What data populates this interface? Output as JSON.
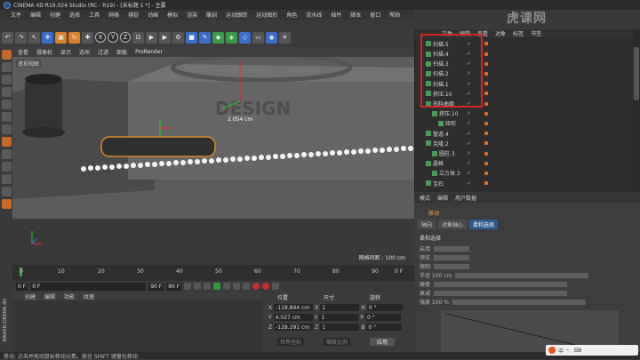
{
  "window": {
    "title": "CINEMA 4D R19.024 Studio (RC - R19) - [未标题 1 *] - 主要"
  },
  "watermark": "虎课网",
  "menu": [
    "文件",
    "编辑",
    "创建",
    "选择",
    "工具",
    "网格",
    "捕捉",
    "动画",
    "模拟",
    "渲染",
    "雕刻",
    "运动跟踪",
    "运动图形",
    "角色",
    "流水线",
    "插件",
    "脚本",
    "窗口",
    "帮助"
  ],
  "viewport": {
    "menu": [
      "查看",
      "摄像机",
      "显示",
      "选项",
      "过滤",
      "面板",
      "ProRender"
    ],
    "label": "透视视图",
    "dimension": "2.054 cm",
    "grid_distance": "网格间距 : 100 cm"
  },
  "timeline": {
    "ticks": [
      "0",
      "10",
      "20",
      "30",
      "40",
      "50",
      "60",
      "70",
      "80",
      "90"
    ],
    "frame_label": "0 F"
  },
  "playbar": {
    "start": "0 F",
    "current": "0 F",
    "end": "90 F",
    "max": "90 F"
  },
  "material_manager": {
    "menu": [
      "创建",
      "编辑",
      "功能",
      "纹理"
    ]
  },
  "coordinates": {
    "headers": [
      "位置",
      "尺寸",
      "旋转"
    ],
    "rows": [
      {
        "axis": "X",
        "pos": "-118.844 cm",
        "size": "1",
        "rot_label": "H",
        "rot": "0 °"
      },
      {
        "axis": "Y",
        "pos": "4.027 cm",
        "size": "1",
        "rot_label": "P",
        "rot": "0 °"
      },
      {
        "axis": "Z",
        "pos": "-128.291 cm",
        "size": "1",
        "rot_label": "B",
        "rot": "0 °"
      }
    ],
    "mode_world": "世界坐标",
    "mode_scale": "缩放比例",
    "apply": "应用"
  },
  "objects": {
    "tabs": [
      "文件",
      "编辑",
      "查看",
      "对象",
      "标签",
      "书签"
    ],
    "items": [
      {
        "name": "扫描.5",
        "indent": 0
      },
      {
        "name": "扫描.4",
        "indent": 0
      },
      {
        "name": "扫描.3",
        "indent": 0
      },
      {
        "name": "扫描.2",
        "indent": 0
      },
      {
        "name": "扫描.1",
        "indent": 0
      },
      {
        "name": "挤压.10",
        "indent": 0
      },
      {
        "name": "布料曲面",
        "indent": 0
      },
      {
        "name": "挤压.10",
        "indent": 1
      },
      {
        "name": "矩形",
        "indent": 2
      },
      {
        "name": "管道.4",
        "indent": 0
      },
      {
        "name": "克隆.2",
        "indent": 0
      },
      {
        "name": "圆柱.3",
        "indent": 1
      },
      {
        "name": "晶格",
        "indent": 0
      },
      {
        "name": "立方体.3",
        "indent": 1
      },
      {
        "name": "宝石",
        "indent": 0
      }
    ]
  },
  "attributes": {
    "tabs": [
      "模式",
      "编辑",
      "用户数据"
    ],
    "header": "移动",
    "subtabs": [
      "轴向",
      "对象轴心",
      "柔和选择"
    ],
    "active_subtab": "柔和选择",
    "section": "柔和选择",
    "rows": [
      "启用",
      "预览",
      "限制",
      "半径 100 cm",
      "硬度",
      "衰减",
      "强度 100 %"
    ]
  },
  "status": {
    "text": "移动: 点击并拖动鼠标移动元素。按住 SHIFT 键量化移动"
  },
  "ime": {
    "label": "中"
  },
  "sidebrand": "MAXON CINEMA 4D"
}
